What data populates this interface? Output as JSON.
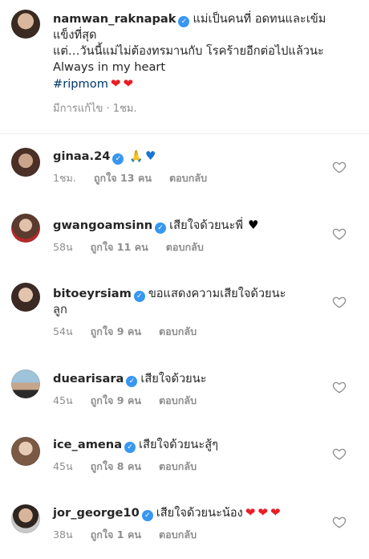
{
  "caption": {
    "username": "namwan_raknapak",
    "line1": "แม่เป็นคนที่ อดทนและเข้ม",
    "line2": "แข็งที่สุด",
    "line3": "แต่…วันนี้แม่ไม่ต้องทรมานกับ โรคร้ายอีกต่อไปแล้วนะ",
    "line4": "Always in my heart",
    "hashtag": "#ripmom",
    "meta": "มีการแก้ไข · 1ชม."
  },
  "comments": [
    {
      "username": "ginaa.24",
      "text": "",
      "time": "1ชม.",
      "likes": "ถูกใจ 13 คน",
      "reply": "ตอบกลับ"
    },
    {
      "username": "gwangoamsinn",
      "text": "เสียใจด้วยนะพี่",
      "time": "58น",
      "likes": "ถูกใจ 11 คน",
      "reply": "ตอบกลับ"
    },
    {
      "username": "bitoeyrsiam",
      "text": "ขอแสดงความเสียใจด้วยนะ",
      "text2": "ลูก",
      "time": "54น",
      "likes": "ถูกใจ 9 คน",
      "reply": "ตอบกลับ"
    },
    {
      "username": "duearisara",
      "text": "เสียใจด้วยนะ",
      "time": "45น",
      "likes": "ถูกใจ 9 คน",
      "reply": "ตอบกลับ"
    },
    {
      "username": "ice_amena",
      "text": "เสียใจด้วยนะสู้ๆ",
      "time": "45น",
      "likes": "ถูกใจ 8 คน",
      "reply": "ตอบกลับ"
    },
    {
      "username": "jor_george10",
      "text": "เสียใจด้วยนะน้อง",
      "time": "38น",
      "likes": "ถูกใจ 1 คน",
      "reply": "ตอบกลับ"
    }
  ],
  "icons": {
    "verified": "verified-badge-icon",
    "like": "heart-outline-icon"
  },
  "colors": {
    "verified": "#3897f0",
    "hashtag": "#00376b",
    "meta": "#8e8e8e"
  }
}
